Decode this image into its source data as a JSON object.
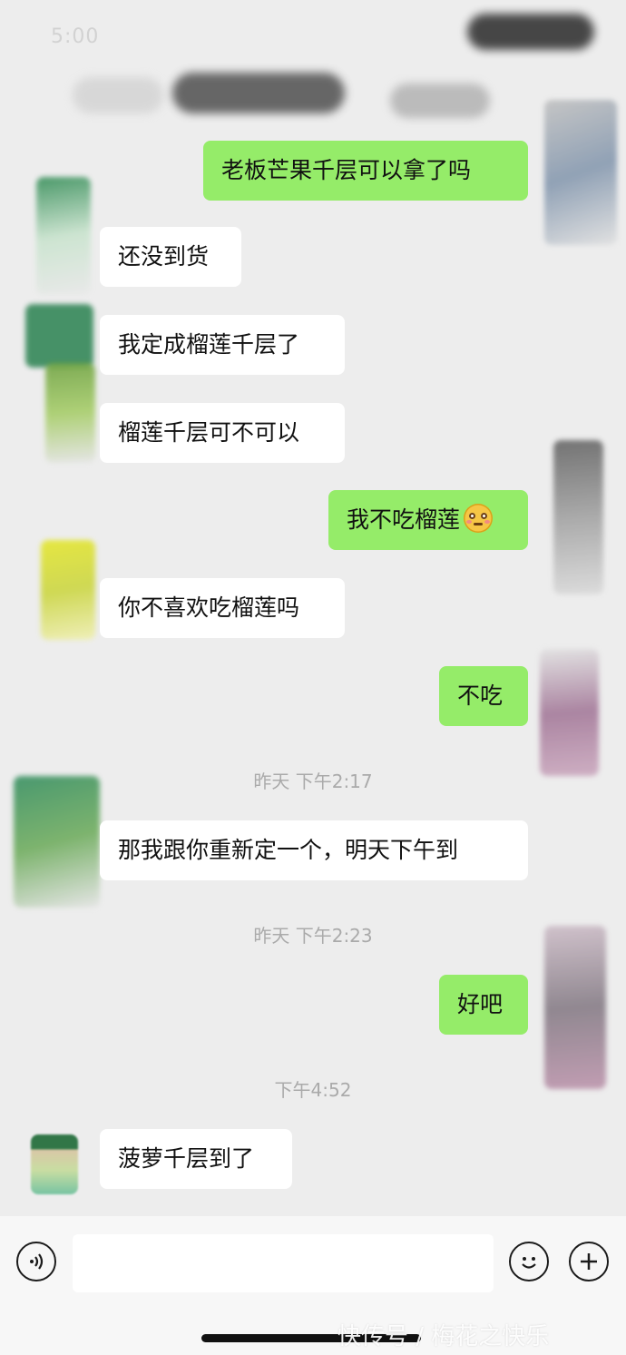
{
  "status_bar": {
    "time": "5:00"
  },
  "messages": [
    {
      "text": "老板芒果千层可以拿了吗"
    },
    {
      "text": "还没到货"
    },
    {
      "text": "我定成榴莲千层了"
    },
    {
      "text": "榴莲千层可不可以"
    },
    {
      "text": "我不吃榴莲",
      "emoji": "flushed-face-emoji"
    },
    {
      "text": "你不喜欢吃榴莲吗"
    },
    {
      "text": "不吃"
    },
    {
      "text": "那我跟你重新定一个，明天下午到"
    },
    {
      "text": "好吧"
    },
    {
      "text": "菠萝千层到了"
    }
  ],
  "timestamps": [
    "昨天 下午2:17",
    "昨天 下午2:23",
    "下午4:52"
  ],
  "watermark": "快传号 / 梅花之快乐",
  "colors": {
    "sent_bubble": "#95ec69",
    "received_bubble": "#ffffff",
    "background": "#ededed"
  },
  "icons": {
    "voice": "voice-icon",
    "emoji": "emoji-icon",
    "plus": "plus-icon"
  }
}
